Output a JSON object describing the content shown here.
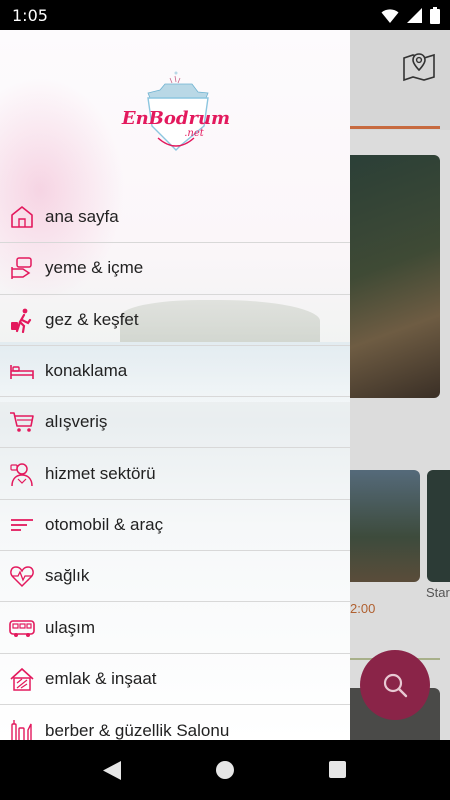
{
  "status_bar": {
    "time": "1:05"
  },
  "drawer": {
    "logo_text": "EnBodrum",
    "logo_subtext": ".net",
    "items": [
      {
        "label": "ana sayfa",
        "icon": "home-icon"
      },
      {
        "label": "yeme & içme",
        "icon": "dining-icon"
      },
      {
        "label": "gez & keşfet",
        "icon": "traveler-icon"
      },
      {
        "label": "konaklama",
        "icon": "bed-icon"
      },
      {
        "label": "alışveriş",
        "icon": "cart-icon"
      },
      {
        "label": "hizmet sektörü",
        "icon": "service-person-icon"
      },
      {
        "label": "otomobil & araç",
        "icon": "car-lines-icon"
      },
      {
        "label": "sağlık",
        "icon": "heartbeat-icon"
      },
      {
        "label": "ulaşım",
        "icon": "bus-icon"
      },
      {
        "label": "emlak & inşaat",
        "icon": "building-icon"
      },
      {
        "label": "berber & güzellik Salonu",
        "icon": "beauty-icon"
      }
    ]
  },
  "background": {
    "time_label": "2:00",
    "partial_label": "Star"
  },
  "colors": {
    "accent": "#e3195d",
    "fab": "#8a2448",
    "divider": "#d8d8d8"
  }
}
